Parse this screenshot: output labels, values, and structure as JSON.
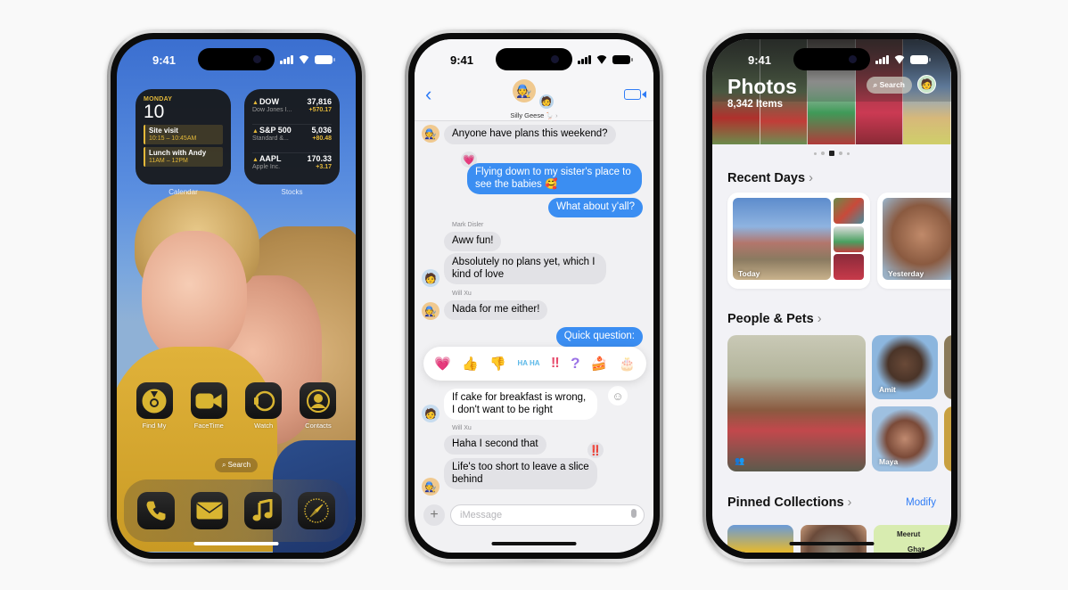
{
  "status_time": "9:41",
  "home": {
    "calendar_widget": {
      "weekday": "MONDAY",
      "date": "10",
      "events": [
        {
          "title": "Site visit",
          "time": "10:15 – 10:45AM"
        },
        {
          "title": "Lunch with Andy",
          "time": "11AM – 12PM"
        }
      ],
      "label": "Calendar"
    },
    "stocks_widget": {
      "label": "Stocks",
      "rows": [
        {
          "symbol": "DOW",
          "name": "Dow Jones I...",
          "value": "37,816",
          "change": "+570.17"
        },
        {
          "symbol": "S&P 500",
          "name": "Standard &...",
          "value": "5,036",
          "change": "+80.48"
        },
        {
          "symbol": "AAPL",
          "name": "Apple Inc.",
          "value": "170.33",
          "change": "+3.17"
        }
      ]
    },
    "apps": [
      {
        "name": "Find My",
        "icon": "find-my-icon"
      },
      {
        "name": "FaceTime",
        "icon": "facetime-icon"
      },
      {
        "name": "Watch",
        "icon": "watch-icon"
      },
      {
        "name": "Contacts",
        "icon": "contacts-icon"
      }
    ],
    "search_label": "Search",
    "dock": [
      {
        "name": "Phone",
        "icon": "phone-icon"
      },
      {
        "name": "Mail",
        "icon": "mail-icon"
      },
      {
        "name": "Music",
        "icon": "music-icon"
      },
      {
        "name": "Safari",
        "icon": "safari-icon"
      }
    ],
    "accent_color": "#d9b531"
  },
  "messages": {
    "group_name": "Silly Geese",
    "group_emoji": "🪿",
    "accent_color": "#3b8ef2",
    "thread": [
      {
        "from": "them",
        "text": "Anyone have plans this weekend?"
      },
      {
        "from": "me",
        "text": "Flying down to my sister's place to see the babies 🥰",
        "tapback": "💗"
      },
      {
        "from": "me",
        "text": "What about y'all?"
      },
      {
        "from": "them",
        "sender": "Mark Disler",
        "text": "Aww fun!"
      },
      {
        "from": "them",
        "text": "Absolutely no plans yet, which I kind of love"
      },
      {
        "from": "them",
        "sender": "Will Xu",
        "text": "Nada for me either!"
      },
      {
        "from": "me",
        "text": "Quick question:"
      },
      {
        "from": "them",
        "text": "If cake for breakfast is wrong, I don't want to be right"
      },
      {
        "from": "them",
        "sender": "Will Xu",
        "text": "Haha I second that"
      },
      {
        "from": "them",
        "text": "Life's too short to leave a slice behind",
        "tapback": "‼️"
      }
    ],
    "reactions": [
      "💗",
      "👍",
      "👎",
      "HA HA",
      "‼",
      "?",
      "🍰",
      "🎂"
    ],
    "input_placeholder": "iMessage"
  },
  "photos": {
    "title": "Photos",
    "item_count": "8,342 Items",
    "search_label": "Search",
    "sections": {
      "recent_days": "Recent Days",
      "people_pets": "People & Pets",
      "pinned": "Pinned Collections"
    },
    "modify_label": "Modify",
    "recent_days": [
      {
        "label": "Today"
      },
      {
        "label": "Yesterday"
      }
    ],
    "people": [
      {
        "name": "Amit"
      },
      {
        "name": "Maya"
      }
    ],
    "map_labels": [
      "Meerut",
      "Ghaz"
    ]
  }
}
